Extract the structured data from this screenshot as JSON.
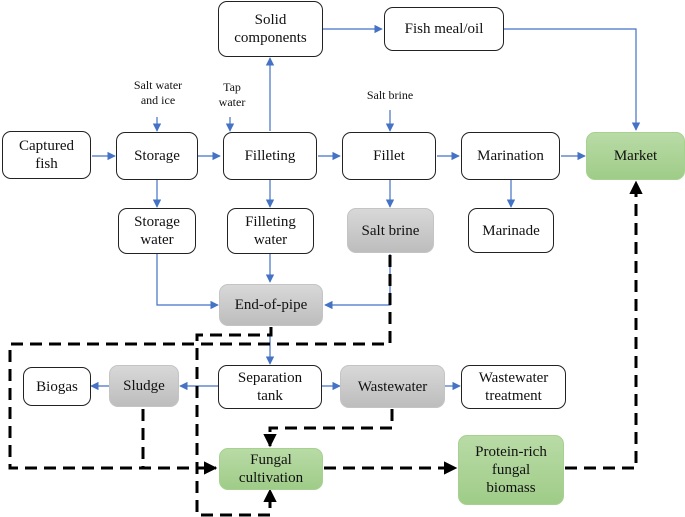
{
  "nodes": {
    "captured_fish": "Captured\nfish",
    "storage": "Storage",
    "filleting": "Filleting",
    "fillet": "Fillet",
    "marination": "Marination",
    "market": "Market",
    "solid_components": "Solid\ncomponents",
    "fish_meal_oil": "Fish meal/oil",
    "storage_water": "Storage\nwater",
    "filleting_water": "Filleting\nwater",
    "salt_brine_out": "Salt brine",
    "marinade": "Marinade",
    "end_of_pipe": "End-of-pipe",
    "separation_tank": "Separation\ntank",
    "sludge": "Sludge",
    "biogas": "Biogas",
    "wastewater": "Wastewater",
    "wastewater_treatment": "Wastewater\ntreatment",
    "fungal_cultivation": "Fungal\ncultivation",
    "protein_biomass": "Protein-rich\nfungal\nbiomass"
  },
  "inputs": {
    "salt_water_ice": "Salt water\nand ice",
    "tap_water": "Tap\nwater",
    "salt_brine_in": "Salt brine"
  },
  "colors": {
    "flow_arrow": "#4472c4",
    "proposed_flow": "#000000",
    "green_node": "#a9d396",
    "gray_node": "#c8c8c8"
  }
}
